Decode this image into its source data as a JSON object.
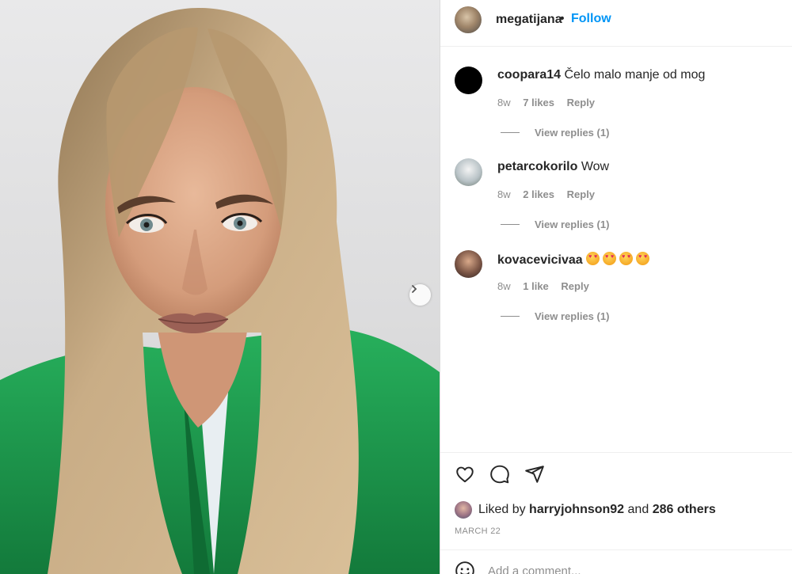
{
  "post": {
    "username": "megatijana",
    "separator": "•",
    "follow_label": "Follow",
    "photo_alt": "Photo by megatijana"
  },
  "comments": [
    {
      "user": "coopara14",
      "text": "Čelo malo manje od mog",
      "age": "8w",
      "likes": "7 likes",
      "reply": "Reply",
      "replies": "View replies (1)",
      "avatar_color": "#000000"
    },
    {
      "user": "petarcokorilo",
      "text": "Wow",
      "age": "8w",
      "likes": "2 likes",
      "reply": "Reply",
      "replies": "View replies (1)",
      "avatar_color": "#cfd4d6"
    },
    {
      "user": "kovacevicivaa",
      "text": "",
      "emoji_count": 4,
      "emoji": "smiling-face-with-heart-eyes",
      "age": "8w",
      "likes": "1 like",
      "reply": "Reply",
      "replies": "View replies (1)",
      "avatar_color": "#6a4e42"
    }
  ],
  "actions": {
    "like_icon": "heart-icon",
    "comment_icon": "comment-icon",
    "share_icon": "send-icon"
  },
  "likes": {
    "prefix": "Liked by",
    "user": "harryjohnson92",
    "middle": "and",
    "others": "286 others"
  },
  "date": "MARCH 22",
  "add_comment": {
    "icon": "emoji-icon",
    "placeholder": "Add a comment..."
  },
  "colors": {
    "accent": "#0095f6",
    "text": "#262626",
    "muted": "#8e8e8e",
    "jacket": "#1f9a4e",
    "hair": "#c2a47c"
  }
}
